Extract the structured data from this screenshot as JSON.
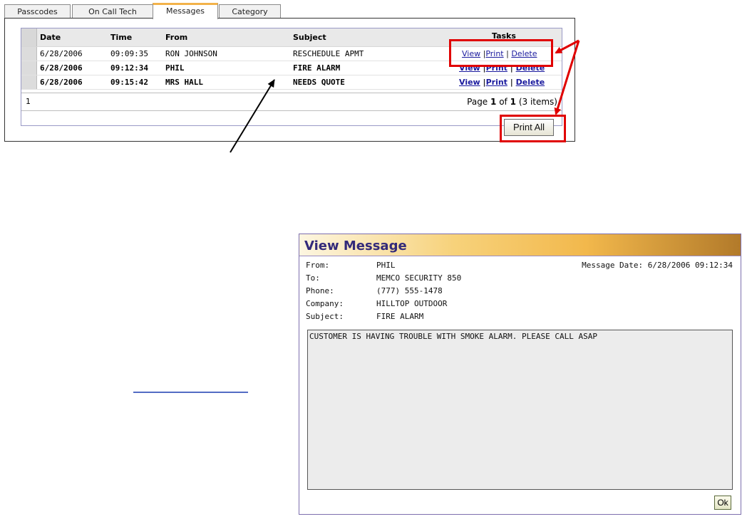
{
  "tabs": [
    "Passcodes",
    "On Call Tech",
    "Messages",
    "Category"
  ],
  "grid": {
    "columns": [
      "Date",
      "Time",
      "From",
      "Subject",
      "Tasks"
    ],
    "rows": [
      {
        "date": "6/28/2006",
        "time": "09:09:35",
        "from": "RON JOHNSON",
        "subject": "RESCHEDULE APMT"
      },
      {
        "date": "6/28/2006",
        "time": "09:12:34",
        "from": "PHIL",
        "subject": "FIRE ALARM"
      },
      {
        "date": "6/28/2006",
        "time": "09:15:42",
        "from": "MRS HALL",
        "subject": "NEEDS QUOTE"
      }
    ],
    "task_links": {
      "view": "View",
      "print": "Print",
      "delete": "Delete"
    },
    "footer": {
      "page_number": "1",
      "page_word": "Page",
      "current": "1",
      "of_word": "of",
      "total": "1",
      "items": "(3 items)"
    }
  },
  "print_all_label": "Print All",
  "dialog": {
    "title": "View Message",
    "fields": [
      {
        "label": "From:",
        "value": "PHIL"
      },
      {
        "label": "To:",
        "value": "MEMCO SECURITY 850"
      },
      {
        "label": "Phone:",
        "value": "(777) 555-1478"
      },
      {
        "label": "Company:",
        "value": "HILLTOP OUTDOOR"
      },
      {
        "label": "Subject:",
        "value": "FIRE ALARM"
      }
    ],
    "message_date": "Message Date: 6/28/2006 09:12:34",
    "body": "CUSTOMER IS HAVING TROUBLE WITH SMOKE ALARM. PLEASE CALL ASAP",
    "ok_label": "Ok"
  },
  "colors": {
    "annotation_red": "#e00000",
    "tab_accent": "#f2b24a",
    "dialog_title": "#332a7a",
    "link": "#1a1a9e"
  }
}
